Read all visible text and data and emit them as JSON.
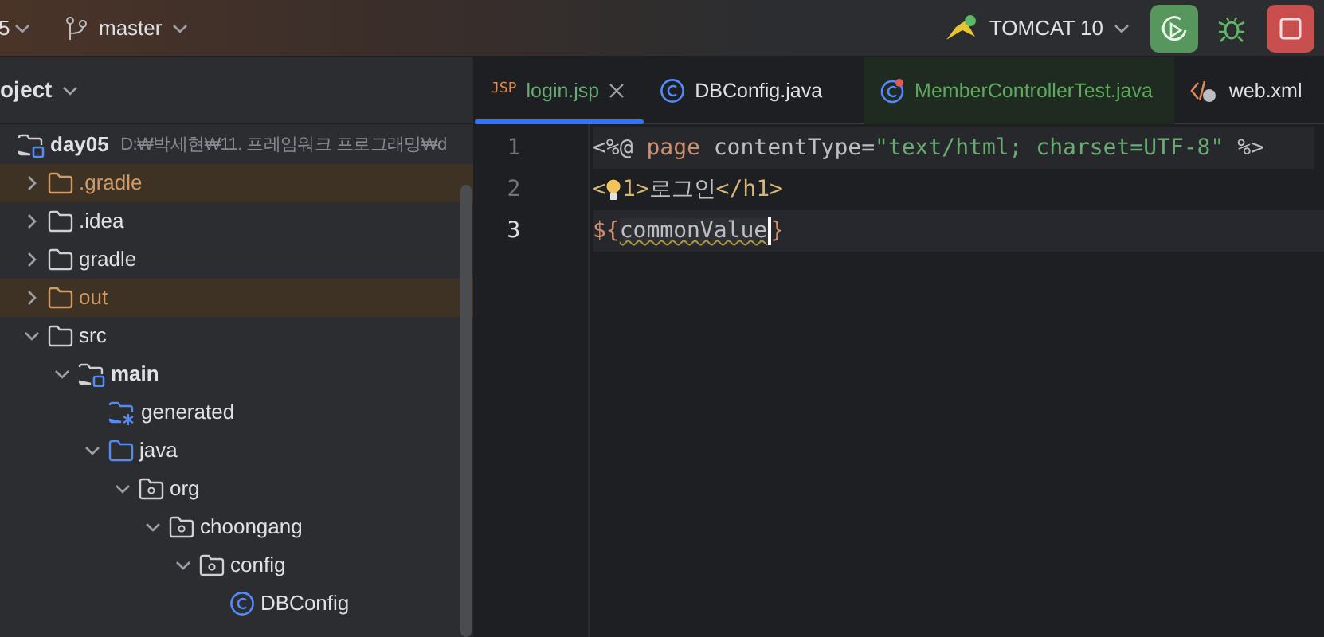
{
  "toolbar": {
    "project_suffix": "5",
    "branch": "master",
    "run_config": "TOMCAT 10"
  },
  "project_panel": {
    "title": "oject",
    "tree": [
      {
        "label": "day05",
        "kind": "module",
        "hint": "D:₩박세현₩11. 프레임워크 프로그래밍₩d",
        "children": [
          {
            "label": ".gradle",
            "kind": "folder",
            "expanded": false,
            "excluded": true
          },
          {
            "label": ".idea",
            "kind": "folder",
            "expanded": false,
            "excluded": false
          },
          {
            "label": "gradle",
            "kind": "folder",
            "expanded": false,
            "excluded": false
          },
          {
            "label": "out",
            "kind": "folder",
            "expanded": false,
            "excluded": true
          },
          {
            "label": "src",
            "kind": "folder",
            "expanded": true,
            "excluded": false,
            "children": [
              {
                "label": "main",
                "kind": "module",
                "expanded": true,
                "children": [
                  {
                    "label": "generated",
                    "kind": "generated"
                  },
                  {
                    "label": "java",
                    "kind": "source",
                    "expanded": true,
                    "children": [
                      {
                        "label": "org",
                        "kind": "package",
                        "expanded": true,
                        "children": [
                          {
                            "label": "choongang",
                            "kind": "package",
                            "expanded": true,
                            "children": [
                              {
                                "label": "config",
                                "kind": "package",
                                "expanded": true,
                                "children": [
                                  {
                                    "label": "DBConfig",
                                    "kind": "class"
                                  }
                                ]
                              }
                            ]
                          }
                        ]
                      }
                    ]
                  }
                ]
              }
            ]
          }
        ]
      }
    ]
  },
  "editor": {
    "tabs": [
      {
        "label": "login.jsp",
        "kind": "jsp",
        "type_label": "JSP",
        "selected": true,
        "closable": true,
        "highlighted": false
      },
      {
        "label": "DBConfig.java",
        "kind": "class",
        "selected": false,
        "highlighted": false
      },
      {
        "label": "MemberControllerTest.java",
        "kind": "test",
        "selected": false,
        "highlighted": true
      },
      {
        "label": "web.xml",
        "kind": "xml",
        "selected": false,
        "highlighted": false
      }
    ],
    "lines": [
      {
        "number": "1",
        "current": false,
        "highlighted": true,
        "tokens": [
          {
            "text": "<%@ ",
            "kind": "plain"
          },
          {
            "text": "page",
            "kind": "keyword"
          },
          {
            "text": " contentType=",
            "kind": "plain"
          },
          {
            "text": "\"text/html; charset=UTF-8\"",
            "kind": "string"
          },
          {
            "text": " %>",
            "kind": "plain"
          }
        ]
      },
      {
        "number": "2",
        "current": false,
        "highlighted": false,
        "tokens": [
          {
            "text": "<",
            "kind": "tag"
          },
          {
            "kind": "bulb"
          },
          {
            "text": "1>",
            "kind": "tag"
          },
          {
            "text": "로그인",
            "kind": "plain"
          },
          {
            "text": "</h1>",
            "kind": "tag"
          }
        ]
      },
      {
        "number": "3",
        "current": true,
        "highlighted": false,
        "tokens": [
          {
            "text": "${",
            "kind": "keyword"
          },
          {
            "text": "commonValue",
            "kind": "warning"
          },
          {
            "kind": "caret"
          },
          {
            "text": "}",
            "kind": "keyword"
          }
        ]
      }
    ]
  }
}
